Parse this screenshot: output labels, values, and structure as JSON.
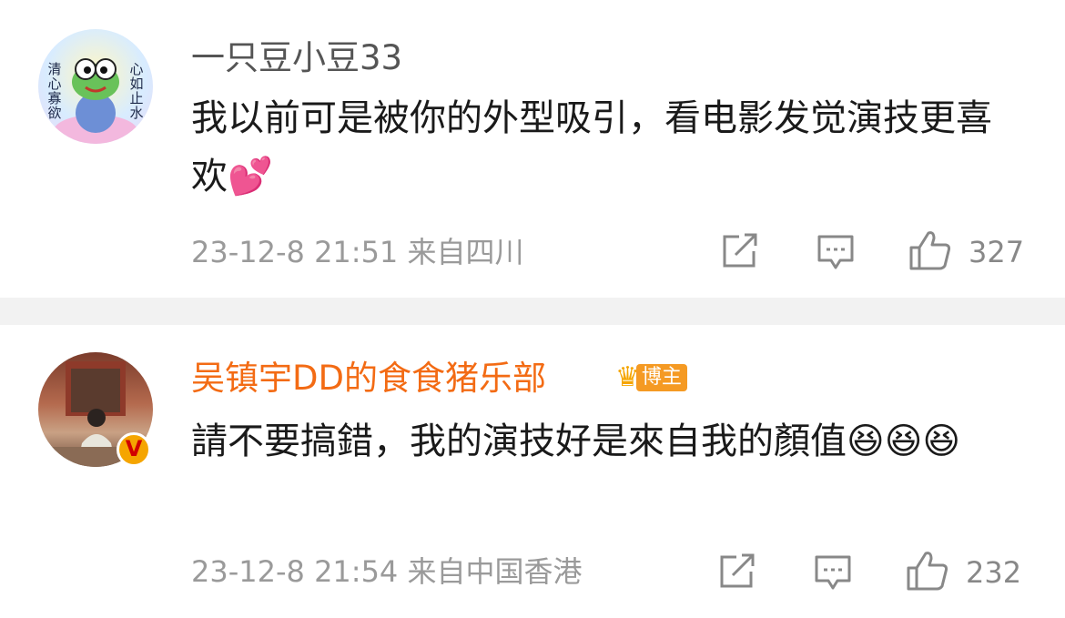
{
  "comments": [
    {
      "username": "一只豆小豆33",
      "avatar": {
        "left_text": "清心寡欲",
        "right_text": "心如止水"
      },
      "text": "我以前可是被你的外型吸引，看电影发觉演技更喜欢",
      "emoji": "💕",
      "meta": "23-12-8 21:51 来自四川",
      "likes": "327"
    },
    {
      "username": "吴镇宇DD的食食猪乐部",
      "badge": "博主",
      "verified_mark": "V",
      "text": "請不要搞錯，我的演技好是來自我的顏值",
      "emoji": "😆😆😆",
      "meta": "23-12-8 21:54 来自中国香港",
      "likes": "232"
    }
  ],
  "colors": {
    "vip_name": "#f36b14",
    "normal_name": "#555555",
    "meta": "#9a9a9a",
    "separator": "#f2f2f2"
  },
  "icons": [
    "share-icon",
    "comment-icon",
    "like-icon",
    "crown-icon"
  ]
}
